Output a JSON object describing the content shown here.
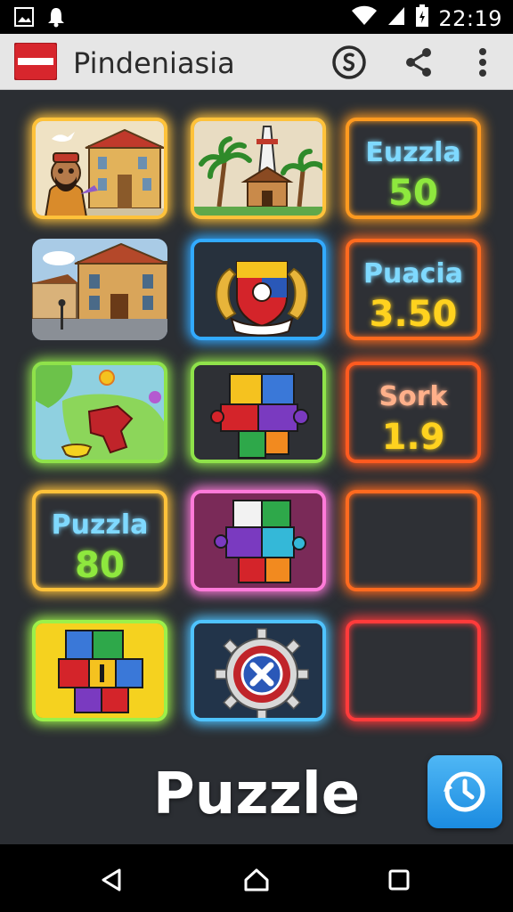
{
  "status_bar": {
    "time": "22:19",
    "left_icons": [
      "image-icon",
      "bell-icon"
    ],
    "right_icons": [
      "wifi-icon",
      "signal-icon",
      "battery-icon"
    ]
  },
  "app_bar": {
    "title": "Pindeniasia",
    "actions": [
      "coin-icon",
      "share-icon",
      "more-vert-icon"
    ]
  },
  "tiles": [
    {
      "type": "image",
      "name": "tile-colonial-man",
      "glow": "#ffc23a"
    },
    {
      "type": "image",
      "name": "tile-palm-monument",
      "glow": "#ffc23a"
    },
    {
      "type": "score",
      "name": "tile-euzzla",
      "label": "Euzzla",
      "value": "50",
      "glow": "#ff9a1f",
      "label_color": "#7fd9ff",
      "value_color": "#8ee83e"
    },
    {
      "type": "image",
      "name": "tile-street-building",
      "glow": "none"
    },
    {
      "type": "image",
      "name": "tile-coat-of-arms",
      "glow": "#32aaff"
    },
    {
      "type": "score",
      "name": "tile-puacia",
      "label": "Puacia",
      "value": "3.50",
      "glow": "#ff6a1f",
      "label_color": "#7fd9ff",
      "value_color": "#ffd21f"
    },
    {
      "type": "image",
      "name": "tile-island-map",
      "glow": "#8fe24a"
    },
    {
      "type": "image",
      "name": "tile-puzzle-pieces-1",
      "glow": "#8fe24a"
    },
    {
      "type": "score",
      "name": "tile-sork",
      "label": "Sork",
      "value": "1.9",
      "glow": "#ff5a1f",
      "label_color": "#ffb08a",
      "value_color": "#ffd21f"
    },
    {
      "type": "score",
      "name": "tile-puzzla",
      "label": "Puzzla",
      "value": "80",
      "glow": "#ffc23a",
      "label_color": "#7fd9ff",
      "value_color": "#8ee83e"
    },
    {
      "type": "image",
      "name": "tile-puzzle-pieces-2",
      "glow": "#ff7ad9"
    },
    {
      "type": "empty",
      "name": "tile-empty-1",
      "glow": "#ff6a1f"
    },
    {
      "type": "image",
      "name": "tile-puzzle-pieces-3",
      "glow": "#9cf04a"
    },
    {
      "type": "image",
      "name": "tile-gear-emblem",
      "glow": "#4fc3ff"
    },
    {
      "type": "empty",
      "name": "tile-empty-2",
      "glow": "#ff3b3b"
    }
  ],
  "footer": {
    "title": "Puzzle",
    "fab_icon": "timer-icon"
  },
  "nav_bar": {
    "buttons": [
      "back-icon",
      "home-icon",
      "recents-icon"
    ]
  }
}
